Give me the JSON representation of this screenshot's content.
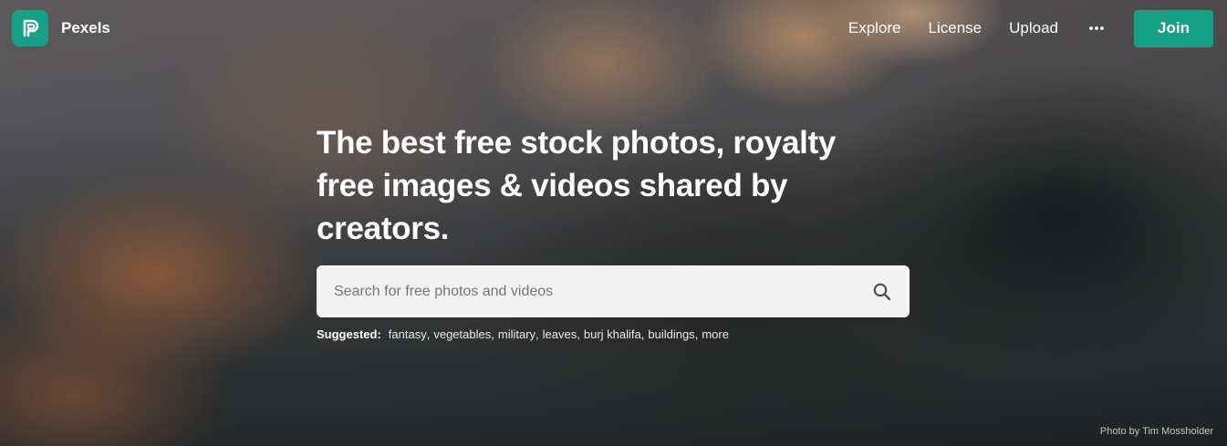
{
  "header": {
    "brand": "Pexels",
    "nav": [
      {
        "label": "Explore"
      },
      {
        "label": "License"
      },
      {
        "label": "Upload"
      }
    ],
    "more_icon": "more-horizontal-icon",
    "join_label": "Join",
    "accent_color": "#16a085"
  },
  "hero": {
    "headline": "The best free stock photos, royalty free images & videos shared by creators.",
    "search": {
      "placeholder": "Search for free photos and videos",
      "icon": "search-icon"
    },
    "suggested_label": "Suggested:",
    "suggestions": [
      "fantasy",
      "vegetables",
      "military",
      "leaves",
      "burj khalifa",
      "buildings",
      "more"
    ]
  },
  "photo_credit": "Photo by Tim Mossholder"
}
